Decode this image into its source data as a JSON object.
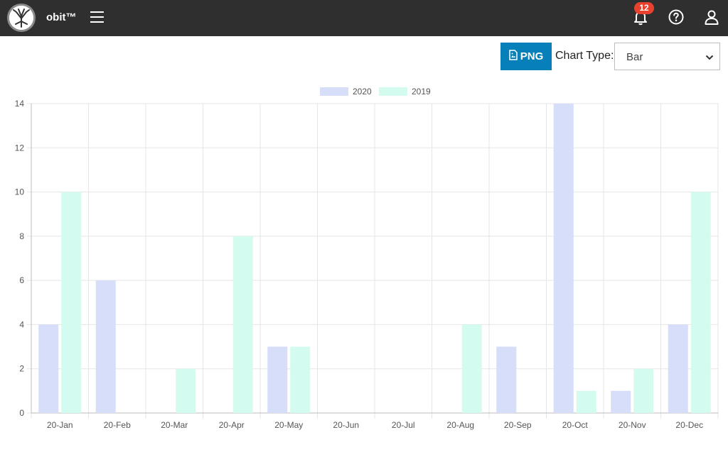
{
  "header": {
    "app_name": "obit™",
    "notification_count": "12",
    "icons": [
      "logo-tree",
      "hamburger-menu",
      "bell",
      "question-circle",
      "user"
    ]
  },
  "toolbar": {
    "png_label": "PNG",
    "chart_type_label": "Chart Type:",
    "chart_type_value": "Bar"
  },
  "colors": {
    "header_bg": "#2f2f2f",
    "accent": "#0780b9",
    "badge": "#e8412e",
    "series_2020": "#d6def9",
    "series_2019": "#d4fbef"
  },
  "chart_data": {
    "type": "bar",
    "categories": [
      "20-Jan",
      "20-Feb",
      "20-Mar",
      "20-Apr",
      "20-May",
      "20-Jun",
      "20-Jul",
      "20-Aug",
      "20-Sep",
      "20-Oct",
      "20-Nov",
      "20-Dec"
    ],
    "series": [
      {
        "name": "2020",
        "values": [
          4,
          6,
          0,
          0,
          3,
          0,
          0,
          0,
          3,
          14,
          1,
          4
        ],
        "color": "#d6def9"
      },
      {
        "name": "2019",
        "values": [
          10,
          0,
          2,
          8,
          3,
          0,
          0,
          4,
          0,
          1,
          2,
          10
        ],
        "color": "#d4fbef"
      }
    ],
    "ylim": [
      0,
      14
    ],
    "yticks": [
      0,
      2,
      4,
      6,
      8,
      10,
      12,
      14
    ],
    "grid": true,
    "legend": "top-center"
  }
}
